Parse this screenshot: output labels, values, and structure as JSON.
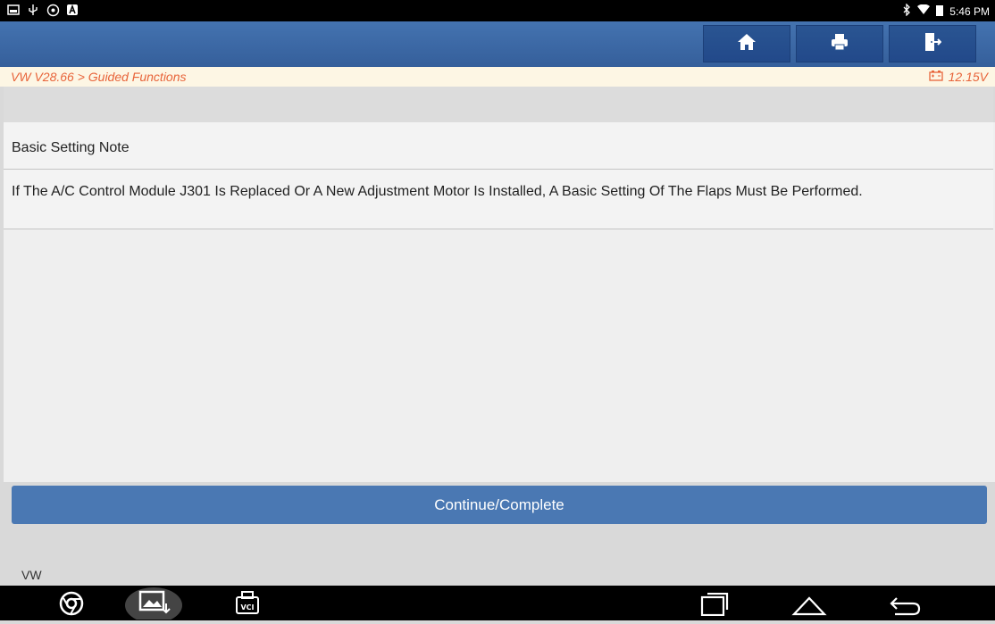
{
  "status_bar": {
    "time": "5:46 PM",
    "left_icons": [
      "image-icon",
      "usb-icon",
      "settings-circle-icon",
      "a-badge-icon"
    ],
    "right_icons": [
      "bluetooth-icon",
      "wifi-icon",
      "battery-icon"
    ]
  },
  "header": {
    "buttons": [
      {
        "name": "home",
        "icon": "home-icon"
      },
      {
        "name": "print",
        "icon": "print-icon"
      },
      {
        "name": "exit",
        "icon": "exit-icon"
      }
    ]
  },
  "breadcrumb": {
    "path": "VW V28.66 > Guided Functions",
    "voltage": "12.15V"
  },
  "content": {
    "title": "Basic Setting Note",
    "message": "If The A/C Control Module J301 Is Replaced Or A New Adjustment Motor Is Installed, A Basic Setting Of The Flaps Must Be Performed."
  },
  "actions": {
    "continue_label": "Continue/Complete"
  },
  "footer": {
    "brand": "VW"
  },
  "nav_bar": {
    "vci_label": "VCI",
    "icons": [
      "chrome-icon",
      "gallery-icon",
      "vci-icon",
      "recents-icon",
      "home-nav-icon",
      "back-icon"
    ]
  },
  "colors": {
    "header_blue": "#3c6aa8",
    "button_blue": "#4a78b3",
    "breadcrumb_text": "#e8643a"
  }
}
